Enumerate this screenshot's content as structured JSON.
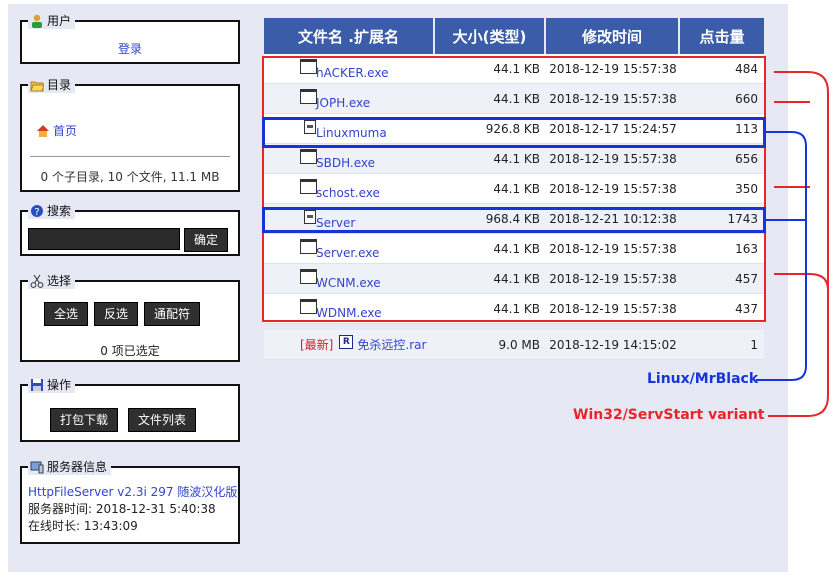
{
  "sidebar": {
    "user": {
      "title": "用户",
      "login_label": "登录"
    },
    "directory": {
      "title": "目录",
      "home_label": "首页",
      "summary": "0 个子目录, 10 个文件, 11.1 MB"
    },
    "search": {
      "title": "搜索",
      "confirm_label": "确定",
      "placeholder": ""
    },
    "select": {
      "title": "选择",
      "select_all_label": "全选",
      "invert_label": "反选",
      "wildcard_label": "通配符",
      "status": "0 项已选定"
    },
    "actions": {
      "title": "操作",
      "download_label": "打包下载",
      "filelist_label": "文件列表"
    },
    "server": {
      "title": "服务器信息",
      "version": "HttpFileServer v2.3i 297 随波汉化版",
      "time": "服务器时间: 2018-12-31 5:40:38",
      "uptime": "在线时长: 13:43:09"
    }
  },
  "table": {
    "headers": [
      "文件名 .扩展名",
      "大小(类型)",
      "修改时间",
      "点击量"
    ],
    "rows": [
      {
        "name": "hACKER.exe",
        "size": "44.1 KB",
        "modified": "2018-12-19 15:57:38",
        "hits": "484",
        "icon": "exe-window-icon"
      },
      {
        "name": "JOPH.exe",
        "size": "44.1 KB",
        "modified": "2018-12-19 15:57:38",
        "hits": "660",
        "icon": "exe-window-icon"
      },
      {
        "name": "Linuxmuma",
        "size": "926.8 KB",
        "modified": "2018-12-17 15:24:57",
        "hits": "113",
        "icon": "generic-file-icon"
      },
      {
        "name": "SBDH.exe",
        "size": "44.1 KB",
        "modified": "2018-12-19 15:57:38",
        "hits": "656",
        "icon": "exe-window-icon"
      },
      {
        "name": "schost.exe",
        "size": "44.1 KB",
        "modified": "2018-12-19 15:57:38",
        "hits": "350",
        "icon": "exe-window-icon"
      },
      {
        "name": "Server",
        "size": "968.4 KB",
        "modified": "2018-12-21 10:12:38",
        "hits": "1743",
        "icon": "generic-file-icon"
      },
      {
        "name": "Server.exe",
        "size": "44.1 KB",
        "modified": "2018-12-19 15:57:38",
        "hits": "163",
        "icon": "exe-window-icon"
      },
      {
        "name": "WCNM.exe",
        "size": "44.1 KB",
        "modified": "2018-12-19 15:57:38",
        "hits": "457",
        "icon": "exe-window-icon"
      },
      {
        "name": "WDNM.exe",
        "size": "44.1 KB",
        "modified": "2018-12-19 15:57:38",
        "hits": "437",
        "icon": "exe-window-icon"
      }
    ],
    "latest": {
      "tag": "[最新]",
      "name": "免杀远控.rar",
      "size": "9.0 MB",
      "modified": "2018-12-19 14:15:02",
      "hits": "1",
      "icon_glyph": "R"
    }
  },
  "annotations": {
    "linux_label": "Linux/MrBlack",
    "win32_label": "Win32/ServStart variant",
    "colors": {
      "red": "#e8262a",
      "blue": "#1535d8",
      "header": "#3b5ca8",
      "link": "#3344cc"
    }
  }
}
